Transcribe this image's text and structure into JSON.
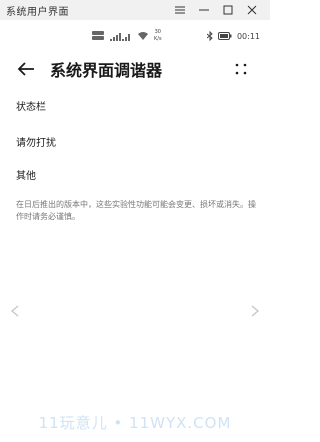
{
  "window": {
    "title": "系统用户界面",
    "buttons": [
      "menu",
      "minimize",
      "maximize",
      "close"
    ]
  },
  "statusbar": {
    "rate_top": "30",
    "rate_bottom": "K/s",
    "time": "00:11",
    "icons": [
      "hd-icon",
      "signal-icon",
      "wifi-icon",
      "bluetooth-icon",
      "battery-icon"
    ]
  },
  "header": {
    "title": "系统界面调谐器"
  },
  "items": [
    {
      "label": "状态栏"
    },
    {
      "label": "请勿打扰"
    },
    {
      "label": "其他"
    }
  ],
  "note": "在日后推出的版本中，这些实验性功能可能会变更、损坏或消失。操作时请务必谨慎。",
  "watermark": "11玩意儿 • 11WYX.COM"
}
